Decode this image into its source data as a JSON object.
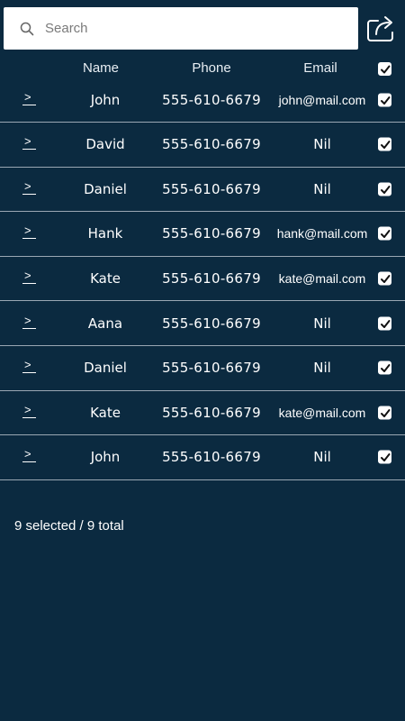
{
  "search": {
    "placeholder": "Search",
    "value": ""
  },
  "header": {
    "name_label": "Name",
    "phone_label": "Phone",
    "email_label": "Email",
    "select_all_checked": true
  },
  "contacts": [
    {
      "name": "John",
      "phone": "555-610-6679",
      "email": "john@mail.com",
      "checked": true
    },
    {
      "name": "David",
      "phone": "555-610-6679",
      "email": "Nil",
      "checked": true
    },
    {
      "name": "Daniel",
      "phone": "555-610-6679",
      "email": "Nil",
      "checked": true
    },
    {
      "name": "Hank",
      "phone": "555-610-6679",
      "email": "hank@mail.com",
      "checked": true
    },
    {
      "name": "Kate",
      "phone": "555-610-6679",
      "email": "kate@mail.com",
      "checked": true
    },
    {
      "name": "Aana",
      "phone": "555-610-6679",
      "email": "Nil",
      "checked": true
    },
    {
      "name": "Daniel",
      "phone": "555-610-6679",
      "email": "Nil",
      "checked": true
    },
    {
      "name": "Kate",
      "phone": "555-610-6679",
      "email": "kate@mail.com",
      "checked": true
    },
    {
      "name": "John",
      "phone": "555-610-6679",
      "email": "Nil",
      "checked": true
    }
  ],
  "footer": {
    "status": "9 selected / 9 total"
  },
  "icons": {
    "search": "search-icon",
    "share": "share-icon",
    "expand": "chevron-right-icon",
    "check": "checkmark-icon"
  },
  "colors": {
    "background": "#0b2a40",
    "row_divider": "#9aa7b3",
    "text": "#ffffff"
  }
}
